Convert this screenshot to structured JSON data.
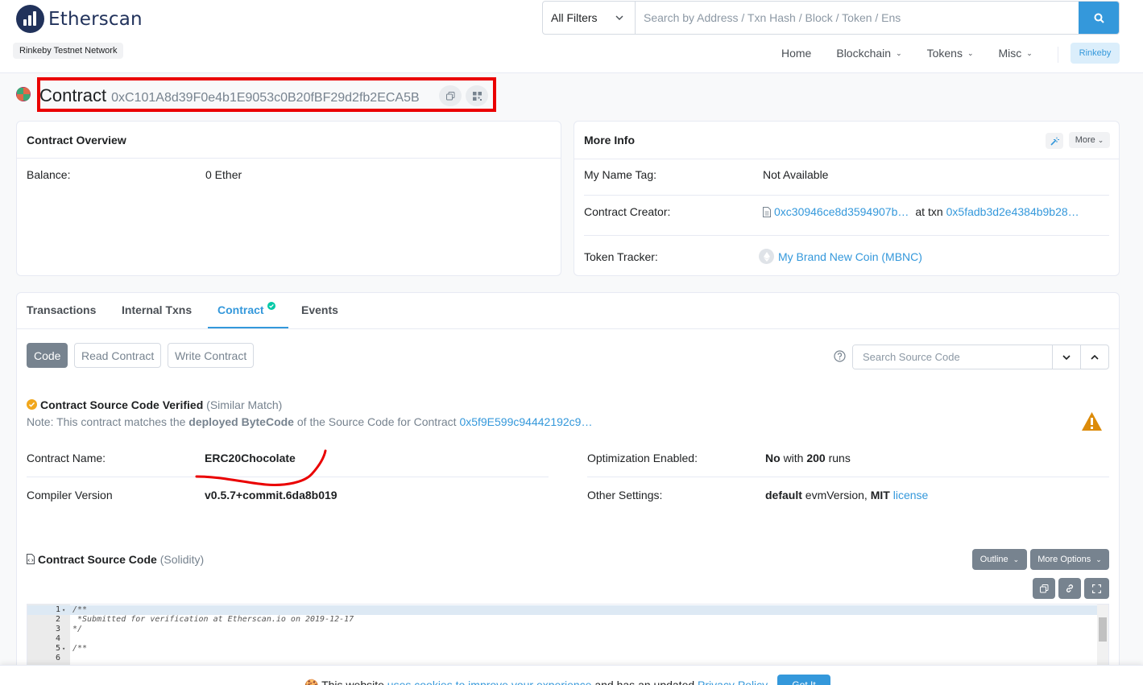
{
  "header": {
    "logo_text": "Etherscan",
    "network_badge": "Rinkeby Testnet Network",
    "filter_label": "All Filters",
    "search_placeholder": "Search by Address / Txn Hash / Block / Token / Ens",
    "nav": [
      "Home",
      "Blockchain",
      "Tokens",
      "Misc"
    ],
    "network_button": "Rinkeby"
  },
  "title": {
    "label": "Contract",
    "address": "0xC101A8d39F0e4b1E9053c0B20fBF29d2fb2ECA5B"
  },
  "overview": {
    "heading": "Contract Overview",
    "balance_label": "Balance:",
    "balance_value": "0 Ether"
  },
  "more_info": {
    "heading": "More Info",
    "more_button": "More",
    "name_tag_label": "My Name Tag:",
    "name_tag_value": "Not Available",
    "creator_label": "Contract Creator:",
    "creator_address": "0xc30946ce8d3594907b…",
    "at_txn": "at txn",
    "creator_txn": "0x5fadb3d2e4384b9b28…",
    "token_tracker_label": "Token Tracker:",
    "token_tracker_value": "My Brand New Coin (MBNC)"
  },
  "tabs": [
    "Transactions",
    "Internal Txns",
    "Contract",
    "Events"
  ],
  "sub_buttons": [
    "Code",
    "Read Contract",
    "Write Contract"
  ],
  "source_search_placeholder": "Search Source Code",
  "verification": {
    "title": "Contract Source Code Verified",
    "match": "(Similar Match)",
    "note_prefix": "Note: This contract matches the",
    "note_bold": "deployed ByteCode",
    "note_mid": "of the Source Code for Contract",
    "note_link": "0x5f9E599c94442192c9…"
  },
  "details": {
    "name_label": "Contract Name:",
    "name_value": "ERC20Chocolate",
    "compiler_label": "Compiler Version",
    "compiler_value": "v0.5.7+commit.6da8b019",
    "opt_label": "Optimization Enabled:",
    "opt_no": "No",
    "opt_with": "with",
    "opt_runs": "200",
    "opt_runs_word": "runs",
    "other_label": "Other Settings:",
    "other_default": "default",
    "other_evm": "evmVersion,",
    "other_mit": "MIT",
    "other_license": "license"
  },
  "source": {
    "heading": "Contract Source Code",
    "language": "(Solidity)",
    "outline_button": "Outline",
    "more_options_button": "More Options"
  },
  "code_lines": [
    {
      "n": "1",
      "fold": "▾",
      "text": "/**"
    },
    {
      "n": "2",
      "fold": "",
      "text": " *Submitted for verification at Etherscan.io on 2019-12-17"
    },
    {
      "n": "3",
      "fold": "",
      "text": "*/"
    },
    {
      "n": "4",
      "fold": "",
      "text": ""
    },
    {
      "n": "5",
      "fold": "▾",
      "text": "/**"
    },
    {
      "n": "6",
      "fold": "",
      "text": ""
    }
  ],
  "cookie": {
    "prefix": "This website",
    "link1": "uses cookies to improve your experience",
    "mid": "and has an updated",
    "link2": "Privacy Policy.",
    "button": "Got It"
  }
}
